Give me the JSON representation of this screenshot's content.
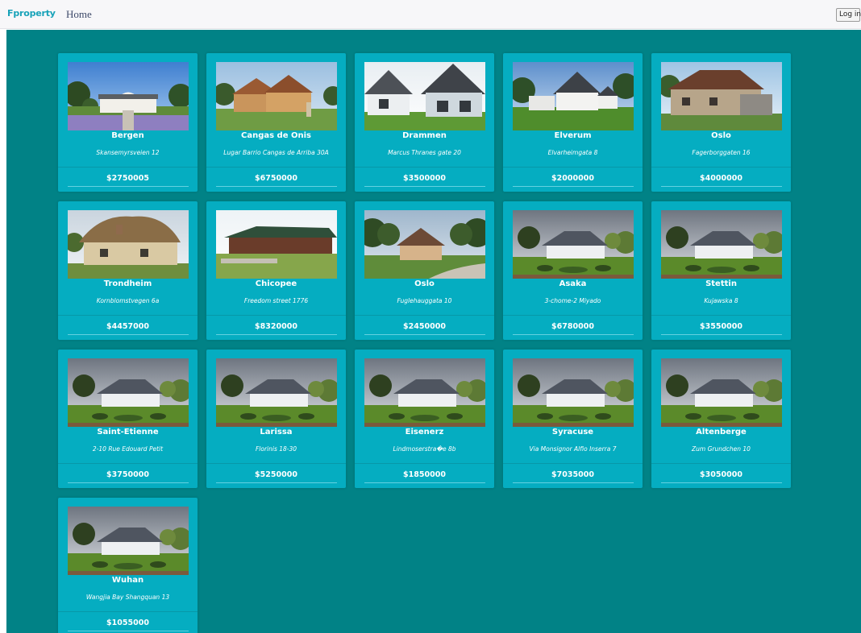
{
  "navbar": {
    "brand": "Fproperty",
    "home_label": "Home",
    "login_label": "Log in"
  },
  "colors": {
    "page_background": "#018286",
    "card_background": "#05adc1",
    "brand_color": "#17a2b8"
  },
  "listings": [
    {
      "city": "Bergen",
      "address": "Skansemyrsveien 12",
      "price": "$2750005",
      "photo": "house-photo-cape-dutch"
    },
    {
      "city": "Cangas de Onis",
      "address": "Lugar Barrio Cangas de Arriba 30A",
      "price": "$6750000",
      "photo": "house-photo-wooden-chalet"
    },
    {
      "city": "Drammen",
      "address": "Marcus Thranes gate 20",
      "price": "$3500000",
      "photo": "house-photo-modern-white"
    },
    {
      "city": "Elverum",
      "address": "Elvarheimgata 8",
      "price": "$2000000",
      "photo": "house-photo-white-gabled"
    },
    {
      "city": "Oslo",
      "address": "Fagerborggaten 16",
      "price": "$4000000",
      "photo": "house-photo-stone-cottage"
    },
    {
      "city": "Trondheim",
      "address": "Kornblomstvegen 6a",
      "price": "$4457000",
      "photo": "house-photo-thatched-cottage"
    },
    {
      "city": "Chicopee",
      "address": "Freedom street 1776",
      "price": "$8320000",
      "photo": "house-photo-log-lodge"
    },
    {
      "city": "Oslo",
      "address": "Fuglehauggata 10",
      "price": "$2450000",
      "photo": "house-photo-forest-house"
    },
    {
      "city": "Asaka",
      "address": "3-chome-2 Miyado",
      "price": "$6780000",
      "photo": "house-photo-garden-house"
    },
    {
      "city": "Stettin",
      "address": "Kujawska 8",
      "price": "$3550000",
      "photo": "house-photo-garden-house"
    },
    {
      "city": "Saint-Etienne",
      "address": "2-10 Rue Edouard Petit",
      "price": "$3750000",
      "photo": "house-photo-garden-house"
    },
    {
      "city": "Larissa",
      "address": "Florinis 18-30",
      "price": "$5250000",
      "photo": "house-photo-garden-house"
    },
    {
      "city": "Eisenerz",
      "address": "Lindmoserstra�e 8b",
      "price": "$1850000",
      "photo": "house-photo-garden-house"
    },
    {
      "city": "Syracuse",
      "address": "Via Monsignor Alfio Inserra 7",
      "price": "$7035000",
      "photo": "house-photo-garden-house"
    },
    {
      "city": "Altenberge",
      "address": "Zum Grundchen 10",
      "price": "$3050000",
      "photo": "house-photo-garden-house"
    },
    {
      "city": "Wuhan",
      "address": "Wangjia Bay Shangquan 13",
      "price": "$1055000",
      "photo": "house-photo-garden-house"
    }
  ]
}
